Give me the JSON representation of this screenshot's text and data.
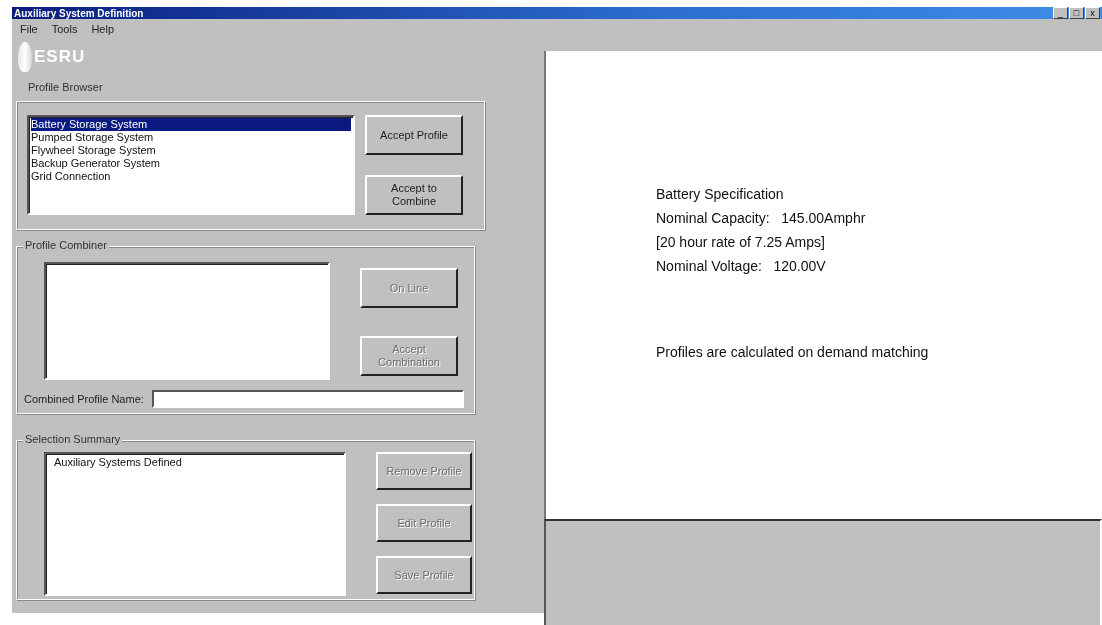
{
  "window": {
    "title": "Auxiliary System Definition",
    "controls": [
      "_",
      "□",
      "x"
    ]
  },
  "menu": [
    {
      "label": "File"
    },
    {
      "label": "Tools"
    },
    {
      "label": "Help"
    }
  ],
  "logo": {
    "text": "ESRU"
  },
  "profile_browser": {
    "title": "Profile Browser",
    "items": [
      {
        "label": "Battery Storage System",
        "selected": true
      },
      {
        "label": "Pumped Storage System",
        "selected": false
      },
      {
        "label": "Flywheel Storage System",
        "selected": false
      },
      {
        "label": "Backup Generator System",
        "selected": false
      },
      {
        "label": "Grid Connection",
        "selected": false
      }
    ],
    "buttons": [
      {
        "label": "Accept Profile",
        "disabled": false
      },
      {
        "label": "Accept to Combine",
        "disabled": false
      }
    ]
  },
  "profile_combiner": {
    "title": "Profile Combiner",
    "buttons": [
      {
        "label": "On Line",
        "disabled": true
      },
      {
        "label": "Accept Combination",
        "disabled": true
      }
    ],
    "name_label": "Combined Profile Name:"
  },
  "selection_summary": {
    "title": "Selection Summary",
    "items": [
      "Auxiliary Systems Defined"
    ],
    "buttons": [
      {
        "label": "Remove Profile",
        "disabled": true
      },
      {
        "label": "Edit Profile",
        "disabled": true
      },
      {
        "label": "Save Profile",
        "disabled": true
      }
    ]
  },
  "details": {
    "lines": [
      "Battery Specification",
      "Nominal Capacity:   145.00Amphr",
      "[20 hour rate of 7.25 Amps]",
      "Nominal Voltage:   120.00V"
    ],
    "note": "Profiles are calculated on demand matching"
  }
}
